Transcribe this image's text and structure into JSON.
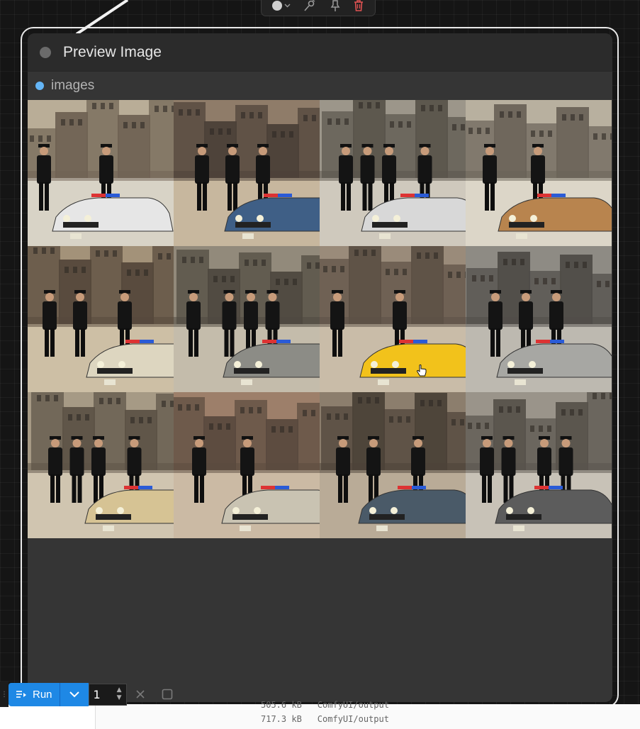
{
  "node": {
    "title": "Preview Image",
    "input_slot_label": "images"
  },
  "toolbar": {
    "icons": [
      "color-picker-icon",
      "chevron-down-icon",
      "bypass-icon",
      "pin-icon",
      "trash-icon"
    ]
  },
  "run_bar": {
    "run_label": "Run",
    "queue_count": "1"
  },
  "footer": {
    "files": [
      {
        "size": "505.6 kB",
        "path": "ComfyUI/output"
      },
      {
        "size": "717.3 kB",
        "path": "ComfyUI/output"
      }
    ]
  },
  "images": [
    {
      "name": "image-1"
    },
    {
      "name": "image-2"
    },
    {
      "name": "image-3"
    },
    {
      "name": "image-4"
    },
    {
      "name": "image-5"
    },
    {
      "name": "image-6"
    },
    {
      "name": "image-7"
    },
    {
      "name": "image-8"
    },
    {
      "name": "image-9"
    },
    {
      "name": "image-10"
    },
    {
      "name": "image-11"
    },
    {
      "name": "image-12"
    }
  ],
  "colors": {
    "accent": "#1e88e5",
    "slot_dot": "#64b5f6",
    "node_bg": "#353535",
    "header_bg": "#2b2b2b"
  }
}
